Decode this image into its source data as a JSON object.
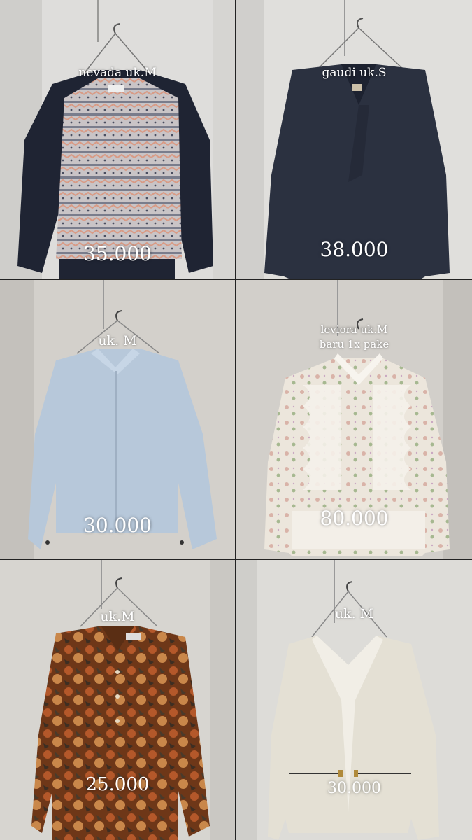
{
  "items": [
    {
      "label": "nevada uk.M",
      "price": "35.000"
    },
    {
      "label": "gaudi uk.S",
      "price": "38.000"
    },
    {
      "label": "uk. M",
      "price": "30.000"
    },
    {
      "label_line1": "leviora uk.M",
      "label_line2": "baru 1x pake",
      "price": "80.000"
    },
    {
      "label": "uk.M",
      "price": "25.000"
    },
    {
      "label": "uk. M",
      "price": "30.000"
    }
  ],
  "colors": {
    "wall": "#d9d9d6",
    "sweater_sleeve": "#1f2433",
    "blouse_navy": "#2b3140",
    "shirt_blue": "#b7c8da",
    "lace_cream": "#ece6dc",
    "floral_brown": "#7a3e1c",
    "cardigan_cream": "#e4e0d4"
  }
}
